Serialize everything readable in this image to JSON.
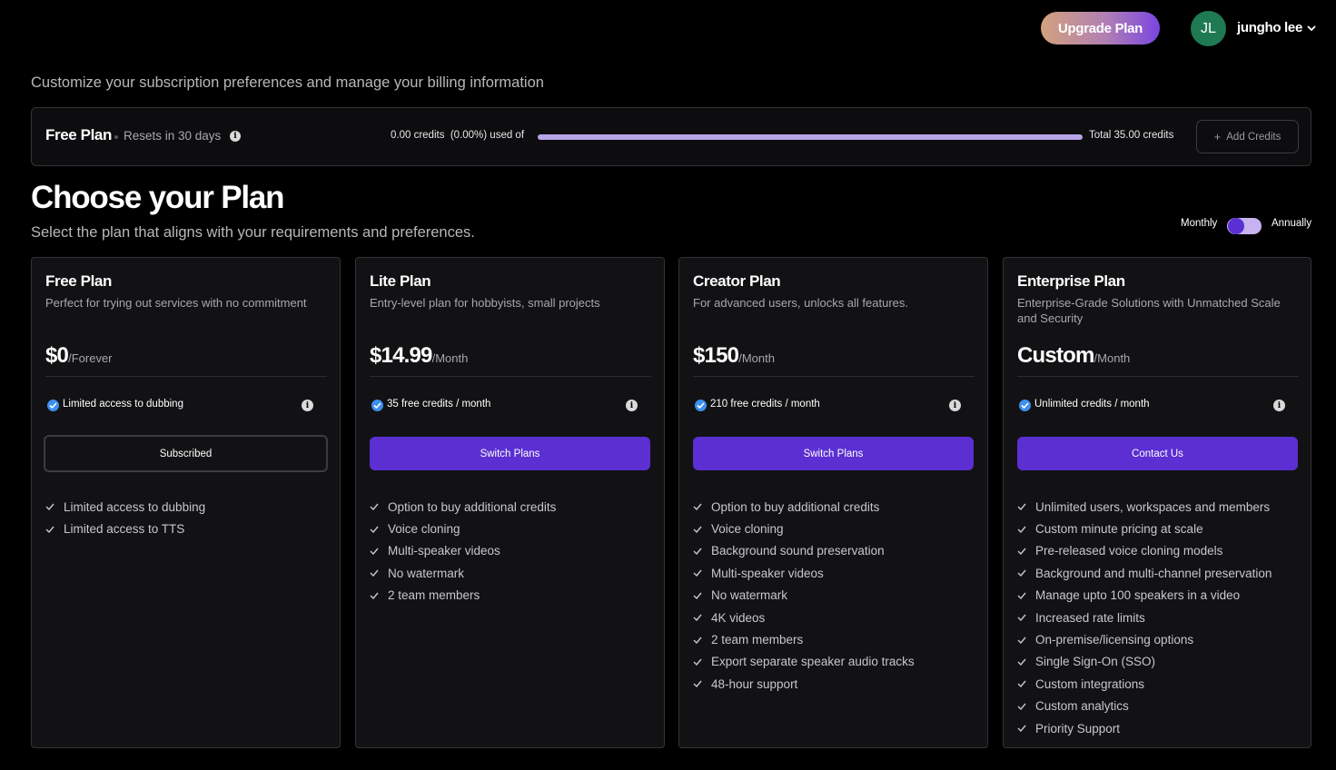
{
  "header": {
    "upgrade_label": "Upgrade Plan",
    "avatar_initials": "JL",
    "user_name": "jungho lee"
  },
  "page_subtitle": "Customize your subscription preferences and manage your billing information",
  "usage": {
    "plan_name": "Free Plan",
    "reset_text": "Resets in 30 days",
    "used_text": "0.00 credits  (0.00%) used of",
    "used_fraction": 0.0,
    "total_text": "Total 35.00 credits",
    "add_credits_label": "Add Credits"
  },
  "choose": {
    "title": "Choose your Plan",
    "subtitle": "Select the plan that aligns with your requirements and preferences.",
    "toggle_left": "Monthly",
    "toggle_right": "Annually",
    "billing_selected": "Monthly"
  },
  "colors": {
    "accent": "#5b2fd2",
    "check_blue": "#3d8ff0",
    "avatar_green": "#1f7a52"
  },
  "plans": [
    {
      "name": "Free Plan",
      "description": "Perfect for trying out services with no commitment",
      "price": "$0",
      "period": "/Forever",
      "credits": "Limited access to dubbing",
      "button": "Subscribed",
      "features": [
        "Limited access to dubbing",
        "Limited access to TTS"
      ]
    },
    {
      "name": "Lite Plan",
      "description": "Entry-level plan for hobbyists, small projects",
      "price": "$14.99",
      "period": "/Month",
      "credits": "35 free credits / month",
      "button": "Switch Plans",
      "features": [
        "Option to buy additional credits",
        "Voice cloning",
        "Multi-speaker videos",
        "No watermark",
        "2 team members"
      ]
    },
    {
      "name": "Creator Plan",
      "description": "For advanced users, unlocks all features.",
      "price": "$150",
      "period": "/Month",
      "credits": "210 free credits / month",
      "button": "Switch Plans",
      "features": [
        "Option to buy additional credits",
        "Voice cloning",
        "Background sound preservation",
        "Multi-speaker videos",
        "No watermark",
        "4K videos",
        "2 team members",
        "Export separate speaker audio tracks",
        "48-hour support"
      ]
    },
    {
      "name": "Enterprise Plan",
      "description": "Enterprise-Grade Solutions with Unmatched Scale and Security",
      "price": "Custom",
      "period": "/Month",
      "credits": "Unlimited credits / month",
      "button": "Contact Us",
      "features": [
        "Unlimited users, workspaces and members",
        "Custom minute pricing at scale",
        "Pre-released voice cloning models",
        "Background and multi-channel preservation",
        "Manage upto 100 speakers in a video",
        "Increased rate limits",
        "On-premise/licensing options",
        "Single Sign-On (SSO)",
        "Custom integrations",
        "Custom analytics",
        "Priority Support"
      ]
    }
  ]
}
